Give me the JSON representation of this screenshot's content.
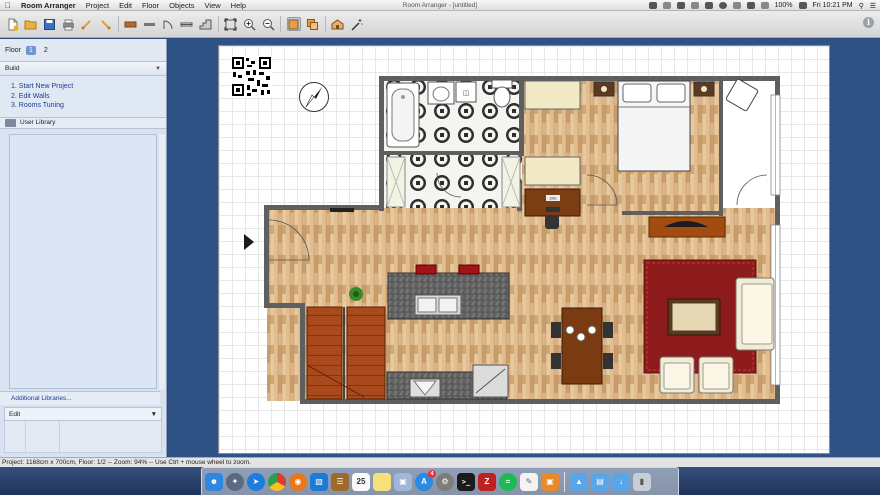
{
  "menubar": {
    "app_name": "Room Arranger",
    "items": [
      "Project",
      "Edit",
      "Floor",
      "Objects",
      "View",
      "Help"
    ],
    "window_title": "Room Arranger - [untitled]",
    "battery": "100%",
    "clock": "Fri 10:21 PM"
  },
  "toolbar": {
    "buttons": [
      "new-project",
      "open",
      "save",
      "print",
      "undo",
      "redo",
      "add-object",
      "add-wall",
      "add-door",
      "add-window",
      "add-stairs",
      "fit-view",
      "zoom-in",
      "zoom-out",
      "select",
      "copy",
      "view-3d",
      "magic"
    ],
    "info_label": "i"
  },
  "sidebar": {
    "floor_label": "Floor",
    "floors": [
      "1",
      "2"
    ],
    "build": {
      "label": "Build",
      "steps": [
        "1. Start New Project",
        "2. Edit Walls",
        "3. Rooms Tuning"
      ]
    },
    "user_library_label": "User Library",
    "additional_libraries_label": "Additional Libraries...",
    "edit_label": "Edit"
  },
  "canvas": {
    "room_label": "1961"
  },
  "status_bar": {
    "text": "Project: 1168cm x 700cm, Floor: 1/2 -- Zoom: 94% -- Use Ctrl + mouse wheel to zoom."
  },
  "dock": {
    "apps": [
      "finder",
      "launchpad",
      "safari",
      "chrome",
      "firefox",
      "app-store-lock",
      "notes",
      "calendar",
      "stickies",
      "preview",
      "app-store",
      "system-preferences",
      "terminal",
      "filezilla",
      "spotify",
      "script-editor",
      "shelf",
      "folder-applications",
      "folder-documents",
      "folder-downloads",
      "trash"
    ],
    "calendar_date": "25",
    "app_store_badge": "4"
  },
  "colors": {
    "accent_blue": "#6f95d3",
    "sidebar_bg": "#d8e2f0",
    "canvas_bg": "#2f5384",
    "floor_wood": "#d8b184",
    "rug_red": "#8f1d1d",
    "stair_brown": "#a44a1c",
    "counter_granite": "#5e5e5e"
  }
}
